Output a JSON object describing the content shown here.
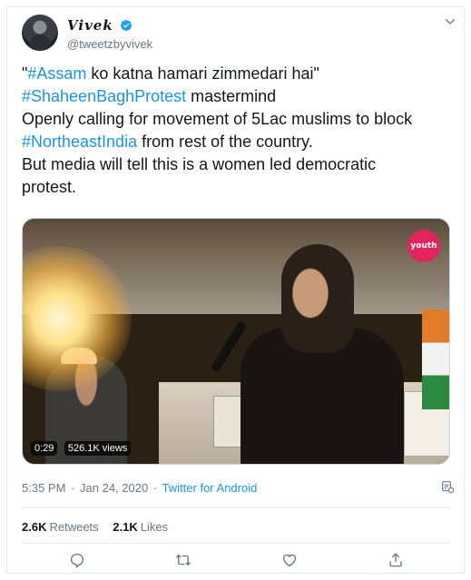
{
  "author": {
    "display_name": "Vivek",
    "handle": "@tweetzbyvivek",
    "verified_icon": "verified-badge-icon"
  },
  "tweet": {
    "lines": [
      {
        "pre": "\"",
        "tag": "#Assam",
        "post": " ko katna hamari zimmedari hai\""
      },
      {
        "pre": "",
        "tag": "#ShaheenBaghProtest",
        "post": " mastermind"
      },
      {
        "pre": "Openly calling for movement of 5Lac muslims to block",
        "tag": "",
        "post": ""
      },
      {
        "pre": "",
        "tag": "#NortheastIndia",
        "post": " from rest of the country."
      },
      {
        "pre": "But media will tell this is a women led democratic",
        "tag": "",
        "post": ""
      },
      {
        "pre": "protest.",
        "tag": "",
        "post": ""
      }
    ]
  },
  "media": {
    "duration": "0:29",
    "views": "526.1K views",
    "logo_text": "youth"
  },
  "meta": {
    "time": "5:35 PM",
    "separator": "·",
    "date": "Jan 24, 2020",
    "source": "Twitter for Android"
  },
  "stats": {
    "retweets_count": "2.6K",
    "retweets_label": "Retweets",
    "likes_count": "2.1K",
    "likes_label": "Likes"
  },
  "colors": {
    "link": "#1b95e0",
    "text": "#14171a",
    "muted": "#657786"
  },
  "icons": [
    "chevron-down-icon",
    "info-icon",
    "reply-icon",
    "retweet-icon",
    "like-icon",
    "share-icon"
  ]
}
